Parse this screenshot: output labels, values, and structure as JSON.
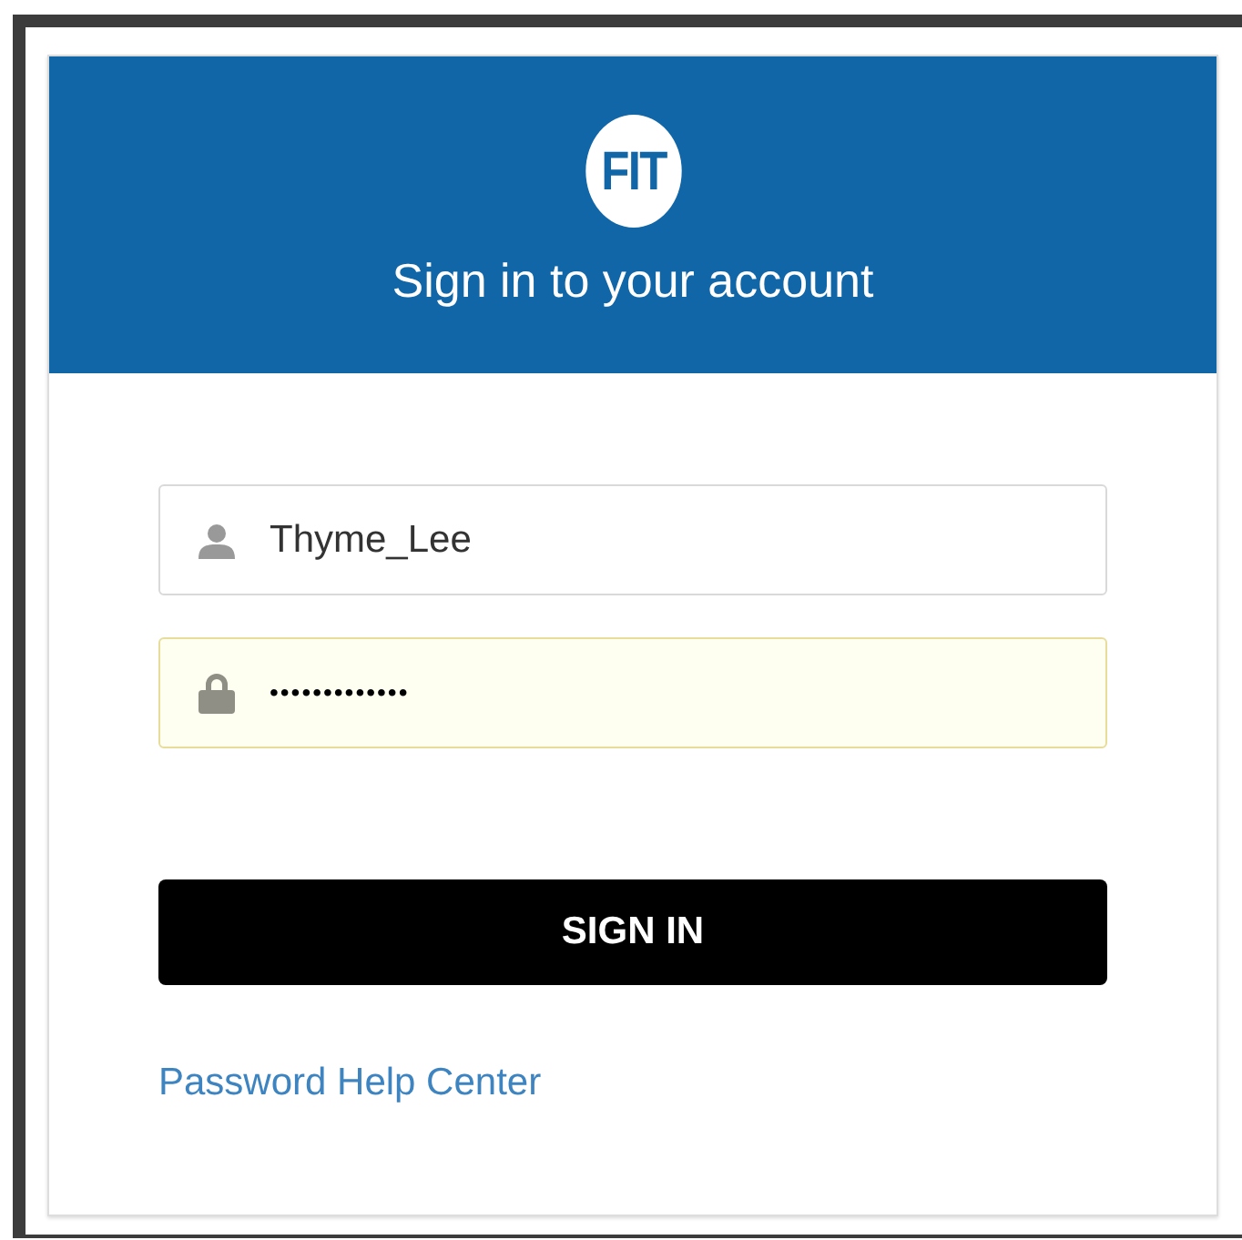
{
  "logo": {
    "text": "FIT"
  },
  "title": "Sign in to your account",
  "fields": [
    {
      "kind": "username",
      "value": "Thyme_Lee",
      "autofilled": false
    },
    {
      "kind": "password",
      "value": "•••••••••••••",
      "autofilled": true
    }
  ],
  "button": "SIGN IN",
  "link": "Password Help Center"
}
